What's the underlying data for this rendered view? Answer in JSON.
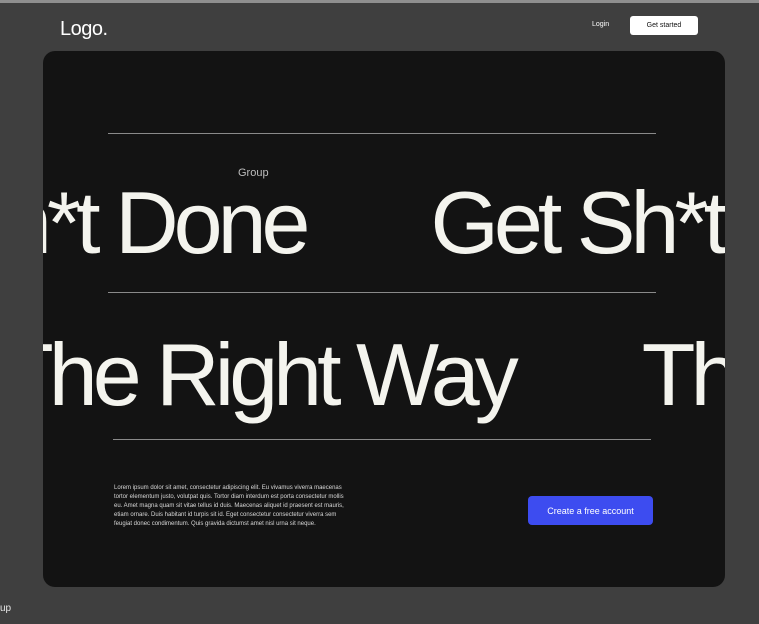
{
  "nav": {
    "logo": "Logo.",
    "login": "Login",
    "get_started": "Get started"
  },
  "hero": {
    "group_label": "Group",
    "marquee_line_1": [
      {
        "text": "Get Sh*t Done"
      },
      {
        "text": "Get Sh*t Done"
      }
    ],
    "marquee_line_2": [
      {
        "text": "The Right Way"
      },
      {
        "text": "The Right Way"
      }
    ],
    "description": "Lorem ipsum dolor sit amet, consectetur adipiscing elit. Eu vivamus viverra maecenas tortor elementum justo, volutpat quis. Tortor diam interdum est porta consectetur mollis eu. Amet magna quam sit vitae tellus id duis. Maecenas aliquet id praesent est mauris, etiam ornare. Duis habitant id turpis sit id. Eget consectetur consectetur viverra sem feugiat donec condimentum. Quis gravida dictumst amet nisl urna sit neque.",
    "cta": "Create a free account"
  },
  "footer": {
    "fragment": "up"
  },
  "colors": {
    "page_bg": "#3f3f3f",
    "hero_bg": "#131313",
    "cta_bg": "#3d4cf0",
    "hero_text": "#f4f4ee"
  }
}
